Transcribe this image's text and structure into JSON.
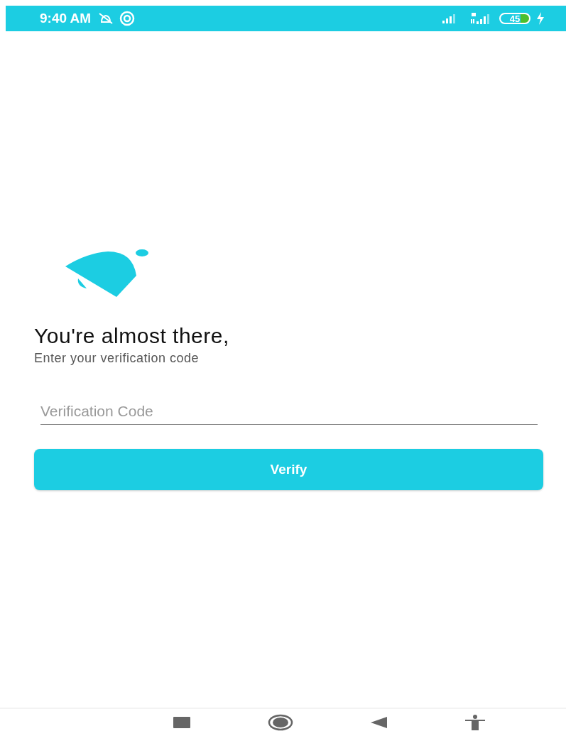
{
  "status_bar": {
    "time": "9:40 AM",
    "battery": "45"
  },
  "heading": "You're almost there,",
  "subheading": "Enter your verification code",
  "code_field": {
    "placeholder": "Verification Code"
  },
  "verify_button": "Verify"
}
